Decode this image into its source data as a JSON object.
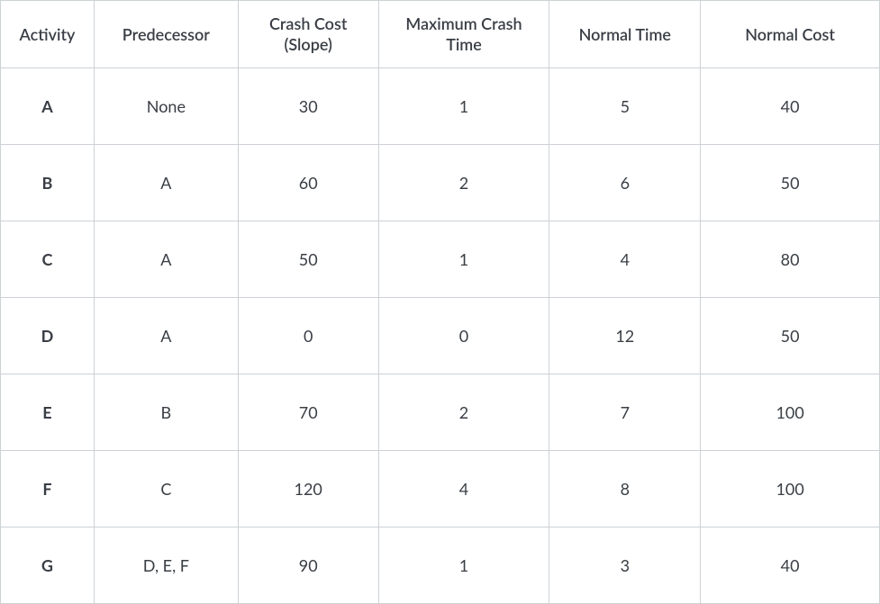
{
  "chart_data": {
    "type": "table",
    "headers": {
      "activity": "Activity",
      "predecessor": "Predecessor",
      "crash_cost_line1": "Crash Cost",
      "crash_cost_line2": "(Slope)",
      "max_crash_line1": "Maximum Crash",
      "max_crash_line2": "Time",
      "normal_time": "Normal Time",
      "normal_cost": "Normal Cost"
    },
    "rows": [
      {
        "activity": "A",
        "predecessor": "None",
        "crash_cost": "30",
        "max_crash": "1",
        "normal_time": "5",
        "normal_cost": "40"
      },
      {
        "activity": "B",
        "predecessor": "A",
        "crash_cost": "60",
        "max_crash": "2",
        "normal_time": "6",
        "normal_cost": "50"
      },
      {
        "activity": "C",
        "predecessor": "A",
        "crash_cost": "50",
        "max_crash": "1",
        "normal_time": "4",
        "normal_cost": "80"
      },
      {
        "activity": "D",
        "predecessor": "A",
        "crash_cost": "0",
        "max_crash": "0",
        "normal_time": "12",
        "normal_cost": "50"
      },
      {
        "activity": "E",
        "predecessor": "B",
        "crash_cost": "70",
        "max_crash": "2",
        "normal_time": "7",
        "normal_cost": "100"
      },
      {
        "activity": "F",
        "predecessor": "C",
        "crash_cost": "120",
        "max_crash": "4",
        "normal_time": "8",
        "normal_cost": "100"
      },
      {
        "activity": "G",
        "predecessor": "D, E, F",
        "crash_cost": "90",
        "max_crash": "1",
        "normal_time": "3",
        "normal_cost": "40"
      }
    ]
  }
}
